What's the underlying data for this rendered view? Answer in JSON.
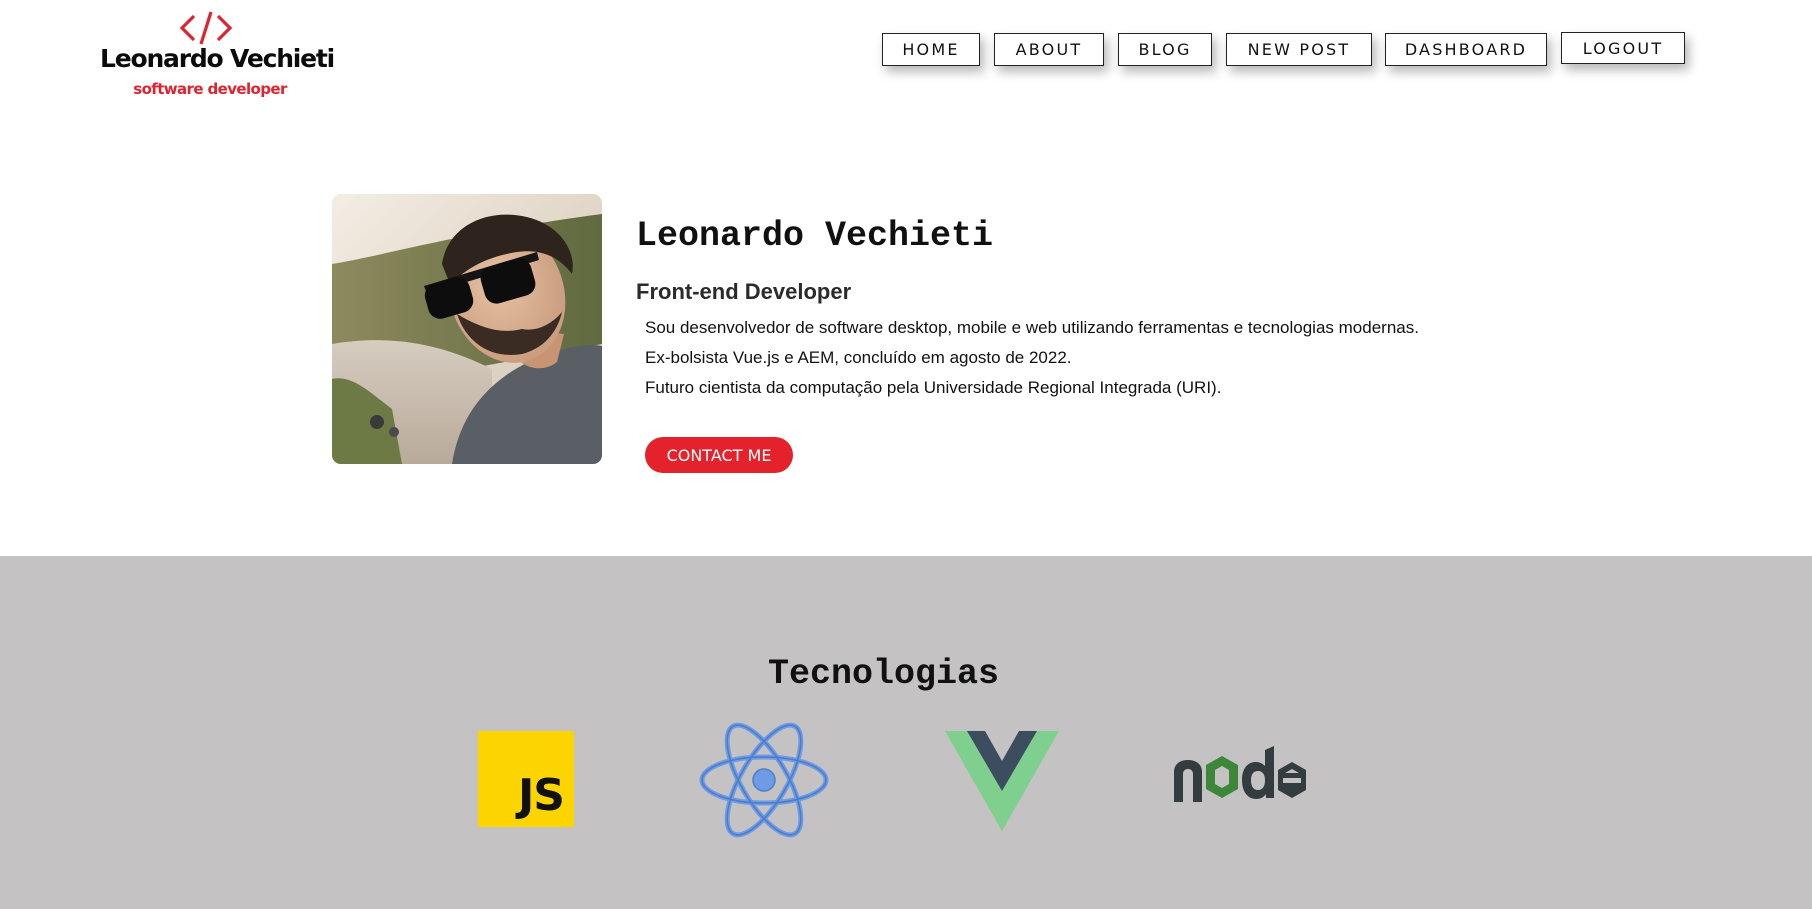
{
  "header": {
    "logo": {
      "name": "Leonardo Vechieti",
      "tagline": "software developer",
      "mark_icon": "code-brackets-icon",
      "mark_color": "#e0242f"
    },
    "nav": {
      "home": "HOME",
      "about": "ABOUT",
      "blog": "BLOG",
      "new_post": "NEW POST",
      "dashboard": "DASHBOARD",
      "logout": "LOGOUT"
    }
  },
  "hero": {
    "photo_icon": "profile-photo",
    "name": "Leonardo Vechieti",
    "role": "Front-end Developer",
    "lines": [
      "Sou desenvolvedor de software desktop, mobile e web utilizando ferramentas e tecnologias modernas.",
      "Ex-bolsista Vue.js e AEM, concluído em agosto de 2022.",
      "Futuro cientista da computação pela Universidade Regional Integrada (URI)."
    ],
    "contact_label": "CONTACT ME",
    "accent_color": "#e3222b"
  },
  "technologies": {
    "title": "Tecnologias",
    "background_color": "#c4c2c3",
    "items": [
      {
        "icon": "javascript-icon",
        "label": "JS",
        "color": "#fcd500"
      },
      {
        "icon": "react-icon",
        "color": "#6d9be6"
      },
      {
        "icon": "vue-icon",
        "colors": [
          "#3fb47f",
          "#3b4d5e"
        ]
      },
      {
        "icon": "node-icon",
        "colors": [
          "#333d3f",
          "#3c873a"
        ]
      }
    ]
  }
}
